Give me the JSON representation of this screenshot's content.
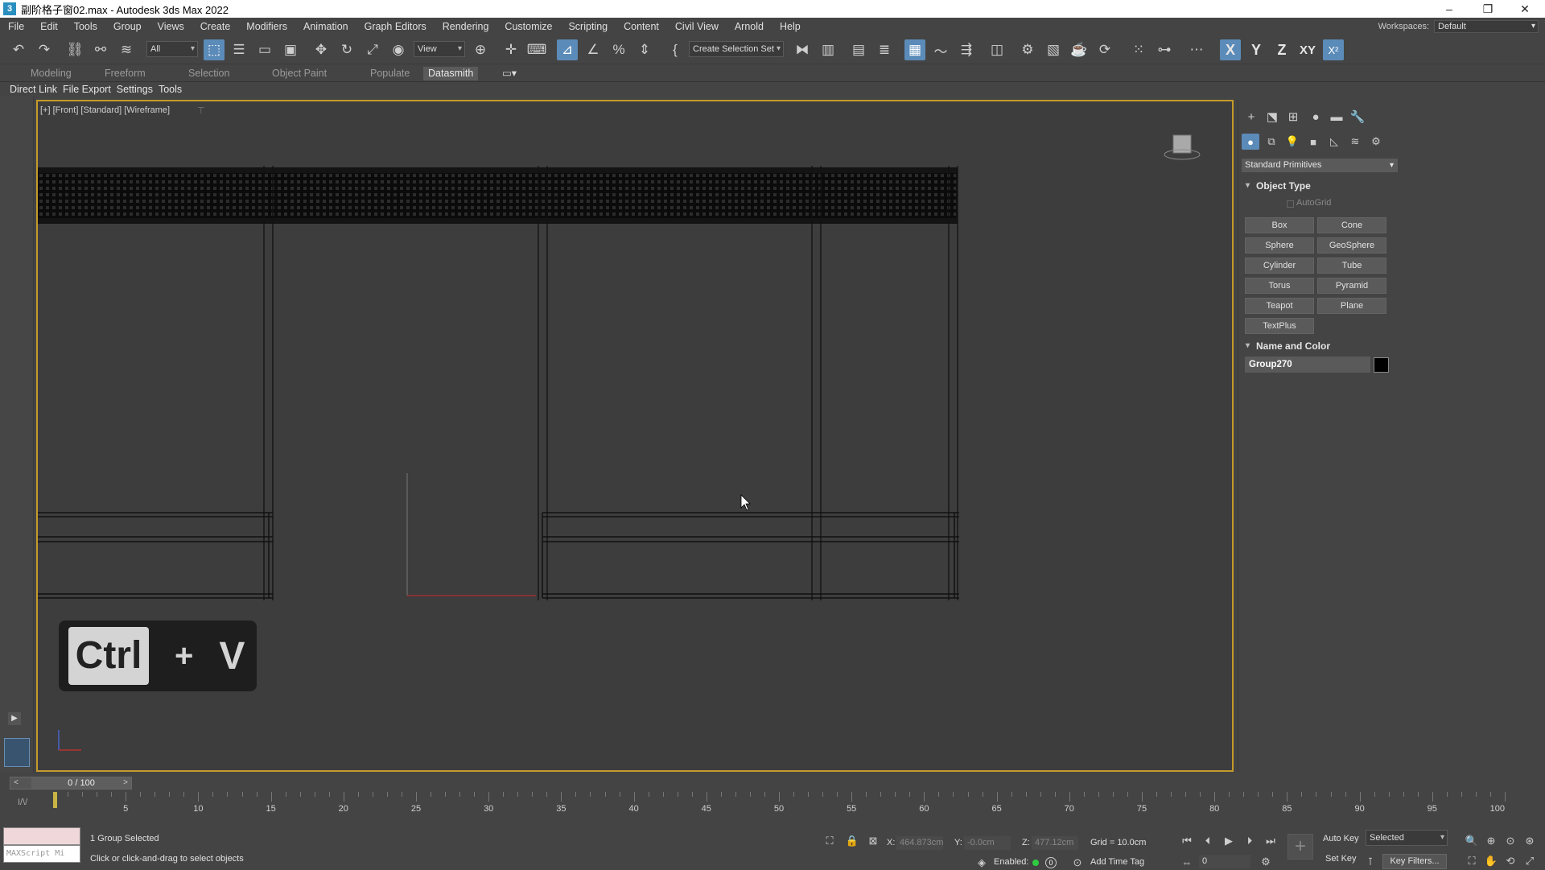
{
  "window": {
    "title": "副阶格子窗02.max - Autodesk 3ds Max 2022",
    "icon_glyph": "3",
    "minimize": "–",
    "maximize": "❐",
    "close": "✕"
  },
  "menu": [
    "File",
    "Edit",
    "Tools",
    "Group",
    "Views",
    "Create",
    "Modifiers",
    "Animation",
    "Graph Editors",
    "Rendering",
    "Customize",
    "Scripting",
    "Content",
    "Civil View",
    "Arnold",
    "Help"
  ],
  "workspaces": {
    "label": "Workspaces:",
    "value": "Default"
  },
  "toolbar": {
    "selection_filter": "All",
    "ref_coord": "View",
    "named_selection": "Create Selection Set",
    "axis": {
      "x": "X",
      "y": "Y",
      "z": "Z",
      "xy": "XY"
    }
  },
  "ribbon": {
    "tabs": [
      "Modeling",
      "Freeform",
      "Selection",
      "Object Paint",
      "Populate",
      "Datasmith"
    ],
    "active": "Datasmith"
  },
  "datasmith": [
    "Direct Link",
    "File Export",
    "Settings",
    "Tools"
  ],
  "viewport": {
    "label": "[+] [Front] [Standard] [Wireframe]",
    "filter_glyph": "⊤"
  },
  "command_panel": {
    "category": "Standard Primitives",
    "object_type_title": "Object Type",
    "autogrid": "AutoGrid",
    "buttons": [
      "Box",
      "Cone",
      "Sphere",
      "GeoSphere",
      "Cylinder",
      "Tube",
      "Torus",
      "Pyramid",
      "Teapot",
      "Plane",
      "TextPlus"
    ],
    "name_color_title": "Name and Color",
    "object_name": "Group270",
    "object_color": "#000000"
  },
  "timeline": {
    "value": "0 / 100",
    "ruler_labels": [
      "5",
      "10",
      "15",
      "20",
      "25",
      "30",
      "35",
      "40",
      "45",
      "50",
      "55",
      "60",
      "65",
      "70",
      "75",
      "80",
      "85",
      "90",
      "95",
      "100"
    ]
  },
  "status": {
    "maxscript_placeholder": "MAXScript Mi",
    "selected": "1 Group Selected",
    "prompt": "Click or click-and-drag to select objects",
    "x_label": "X:",
    "x_value": "464.873cm",
    "y_label": "Y:",
    "y_value": "-0.0cm",
    "z_label": "Z:",
    "z_value": "477.12cm",
    "grid": "Grid = 10.0cm",
    "enabled_label": "Enabled:",
    "enabled_value": "0",
    "add_time_tag": "Add Time Tag",
    "auto_key": "Auto Key",
    "set_key": "Set Key",
    "key_mode": "Selected",
    "key_filters": "Key Filters...",
    "frame": "0"
  },
  "overlay": {
    "key1": "Ctrl",
    "plus": "+",
    "key2": "V"
  },
  "colors": {
    "accent": "#5b8bb9",
    "viewport_border": "#c49a2b"
  }
}
